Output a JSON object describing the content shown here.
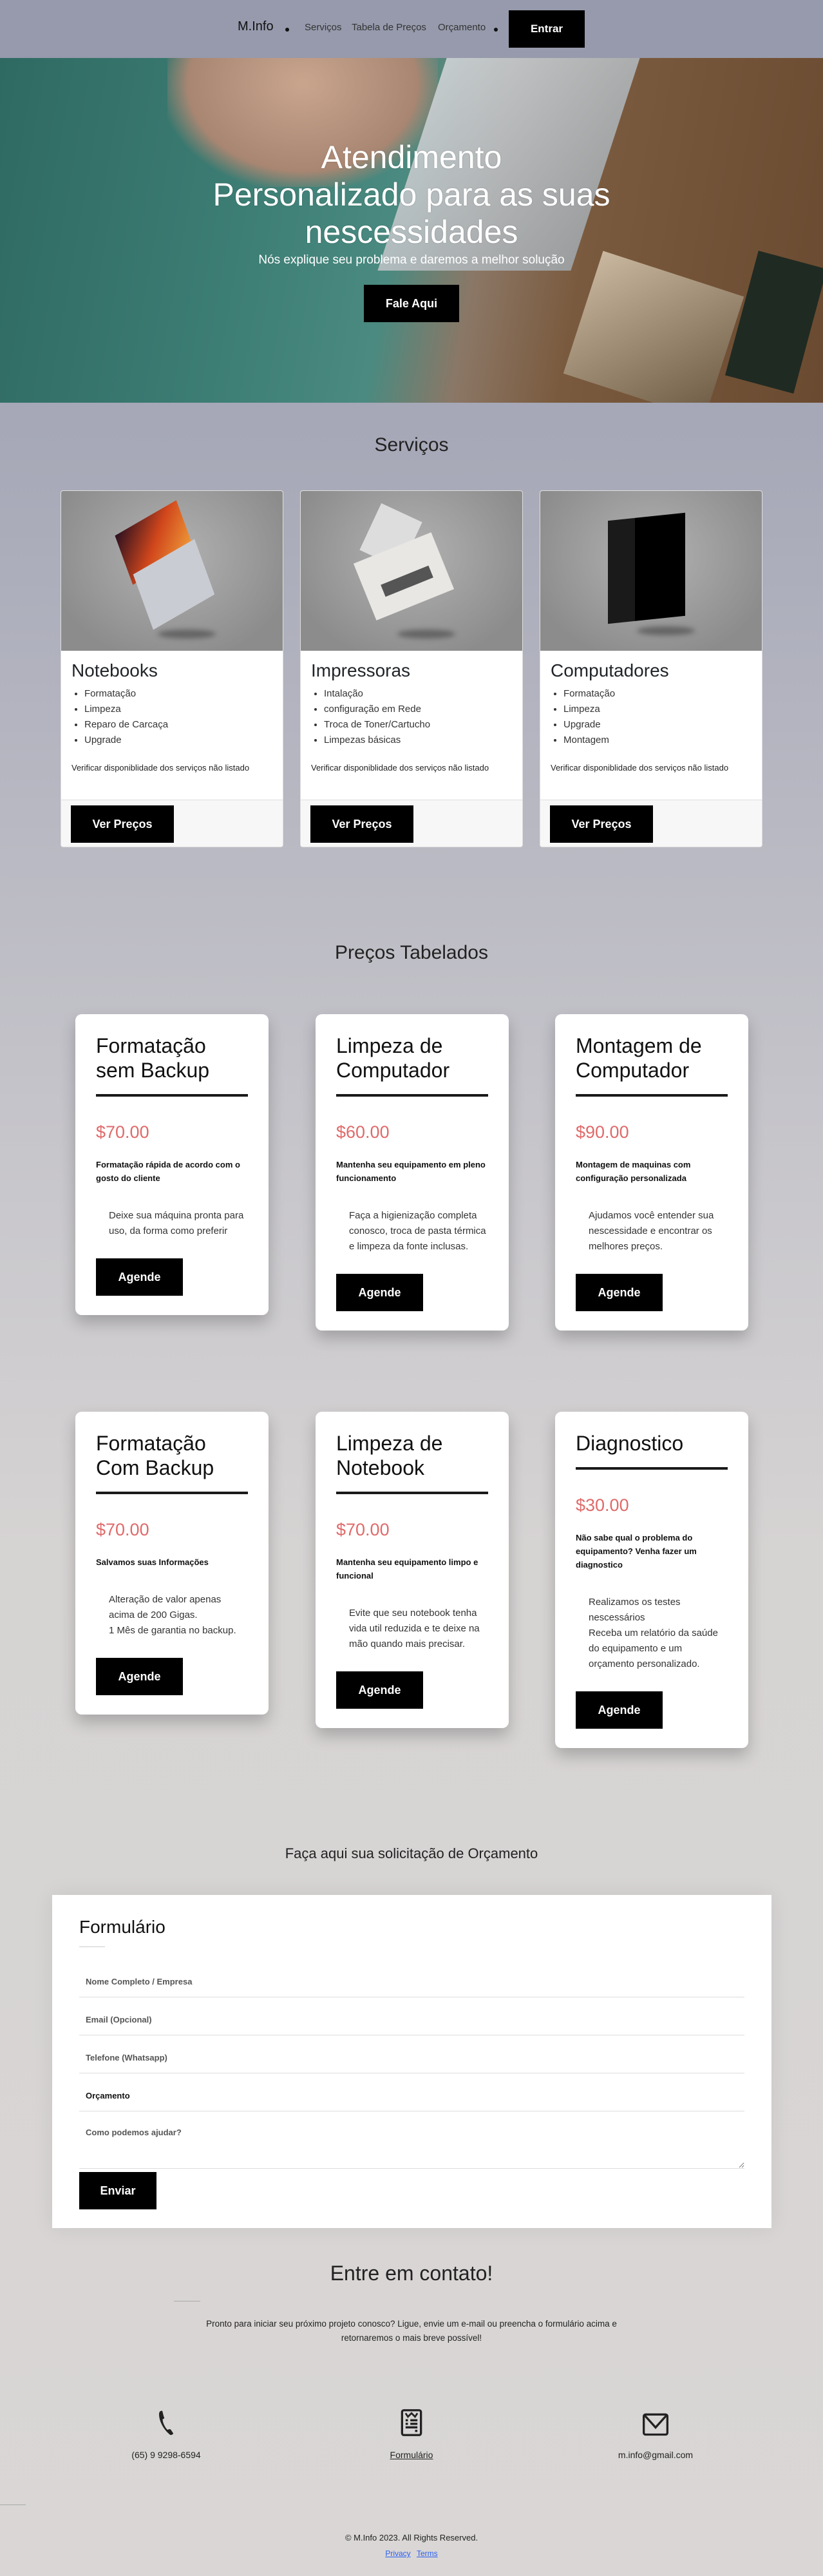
{
  "nav": {
    "brand": "M.Info",
    "links": [
      "Serviços",
      "Tabela de Preços",
      "Orçamento"
    ],
    "login": "Entrar"
  },
  "hero": {
    "title_lines": [
      "Atendimento",
      "Personalizado para as suas",
      "nescessidades"
    ],
    "subtitle": "Nós explique seu problema e daremos a melhor solução",
    "cta": "Fale Aqui"
  },
  "services": {
    "title": "Serviços",
    "cards": [
      {
        "title": "Notebooks",
        "items": [
          "Formatação",
          "Limpeza",
          "Reparo de Carcaça",
          "Upgrade"
        ],
        "note": "Verificar disponiblidade dos serviços não listado",
        "button": "Ver Preços"
      },
      {
        "title": "Impressoras",
        "items": [
          "Intalação",
          "configuração em Rede",
          "Troca de Toner/Cartucho",
          "Limpezas básicas"
        ],
        "note": "Verificar disponiblidade dos serviços não listado",
        "button": "Ver Preços"
      },
      {
        "title": "Computadores",
        "items": [
          "Formatação",
          "Limpeza",
          "Upgrade",
          "Montagem"
        ],
        "note": "Verificar disponiblidade dos serviços não listado",
        "button": "Ver Preços"
      }
    ]
  },
  "pricing": {
    "title": "Preços Tabelados",
    "price_color": "#e06a6a",
    "cards": [
      {
        "title": "Formatação sem Backup",
        "price": "$70.00",
        "desc": "Formatação rápida de acordo com o gosto do cliente",
        "body": [
          "Deixe sua máquina pronta para uso, da forma como preferir"
        ],
        "button": "Agende"
      },
      {
        "title": "Limpeza de Computador",
        "price": "$60.00",
        "desc": "Mantenha seu equipamento em pleno funcionamento",
        "body": [
          "Faça a higienização completa conosco, troca de pasta térmica e limpeza da fonte inclusas."
        ],
        "button": "Agende"
      },
      {
        "title": "Montagem de Computador",
        "price": "$90.00",
        "desc": "Montagem de maquinas com configuração personalizada",
        "body": [
          "Ajudamos você entender sua nescessidade e encontrar os melhores preços."
        ],
        "button": "Agende"
      },
      {
        "title": "Formatação Com Backup",
        "price": "$70.00",
        "desc": "Salvamos suas Informações",
        "body": [
          "Alteração de valor apenas acima de 200 Gigas.",
          "1 Mês de garantia no backup."
        ],
        "button": "Agende"
      },
      {
        "title": "Limpeza de Notebook",
        "price": "$70.00",
        "desc": "Mantenha seu equipamento limpo e funcional",
        "body": [
          "Evite que seu notebook tenha vida util reduzida e te deixe na mão quando mais precisar."
        ],
        "button": "Agende"
      },
      {
        "title": "Diagnostico",
        "price": "$30.00",
        "desc": "Não sabe qual o problema do equipamento? Venha fazer um diagnostico",
        "body": [
          "Realizamos os testes nescessários",
          "Receba um relatório da saúde do equipamento e um orçamento personalizado."
        ],
        "button": "Agende"
      }
    ]
  },
  "quote": {
    "title": "Faça aqui sua solicitação de Orçamento",
    "form_title": "Formulário",
    "fields": {
      "name": "Nome Completo / Empresa",
      "email": "Email (Opcional)",
      "phone": "Telefone (Whatsapp)",
      "budget": "Orçamento",
      "message": "Como podemos ajudar?"
    },
    "submit": "Enviar"
  },
  "contact": {
    "title": "Entre em contato!",
    "text": "Pronto para iniciar seu próximo projeto conosco? Ligue, envie um e-mail ou preencha o formulário acima e retornaremos o mais breve possível!",
    "phone": "(65) 9 9298-6594",
    "form_link": "Formulário",
    "email": "m.info@gmail.com"
  },
  "footer": {
    "copyright": "© M.Info 2023. All Rights Reserved.",
    "privacy": "Privacy",
    "terms": "Terms"
  }
}
